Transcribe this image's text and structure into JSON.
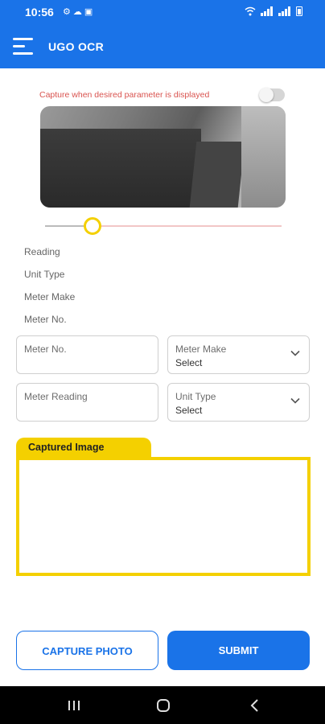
{
  "status_bar": {
    "time": "10:56",
    "left_icons": [
      "settings-icon",
      "cloud-icon",
      "teams-icon"
    ],
    "right_icons": [
      "wifi-icon",
      "signal-icon",
      "signal-icon",
      "battery-icon"
    ]
  },
  "app_bar": {
    "title": "UGO OCR",
    "background": "#1a73e8"
  },
  "capture": {
    "hint": "Capture when desired parameter is displayed",
    "toggle_on": false
  },
  "zoom_slider": {
    "value_fraction": 0.2
  },
  "info": {
    "reading_label": "Reading",
    "unit_type_label": "Unit Type",
    "meter_make_label": "Meter Make",
    "meter_no_label": "Meter No."
  },
  "form": {
    "meter_no_label": "Meter No.",
    "meter_make_label": "Meter Make",
    "meter_make_value": "Select",
    "meter_reading_label": "Meter Reading",
    "unit_type_label": "Unit Type",
    "unit_type_value": "Select"
  },
  "captured_image": {
    "title": "Captured Image",
    "accent": "#f4d000"
  },
  "buttons": {
    "capture_label": "CAPTURE PHOTO",
    "submit_label": "SUBMIT"
  }
}
